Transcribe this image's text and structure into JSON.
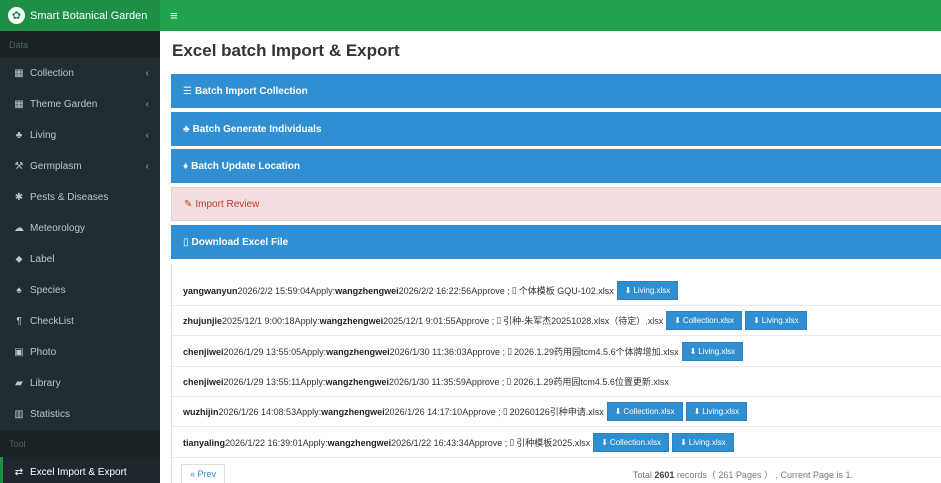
{
  "app": {
    "title": "Smart Botanical Garden",
    "menu_toggle": "≡",
    "accent_color": "#22a34e",
    "sidebar_bg": "#222d32"
  },
  "sidebar": {
    "section_data": "Data",
    "section_tool": "Tool",
    "items": [
      {
        "label": "Collection",
        "icon": "table-icon",
        "glyph": "▦",
        "has_children": true
      },
      {
        "label": "Theme Garden",
        "icon": "grid-icon",
        "glyph": "▦",
        "has_children": true
      },
      {
        "label": "Living",
        "icon": "tree-icon",
        "glyph": "♣",
        "has_children": true
      },
      {
        "label": "Germplasm",
        "icon": "magic-icon",
        "glyph": "⚒",
        "has_children": true
      },
      {
        "label": "Pests & Diseases",
        "icon": "bug-icon",
        "glyph": "✱",
        "has_children": false
      },
      {
        "label": "Meteorology",
        "icon": "cloud-icon",
        "glyph": "☁",
        "has_children": false
      },
      {
        "label": "Label",
        "icon": "tag-icon",
        "glyph": "⬥",
        "has_children": false
      },
      {
        "label": "Species",
        "icon": "leaf-icon",
        "glyph": "♠",
        "has_children": false
      },
      {
        "label": "CheckList",
        "icon": "paragraph-icon",
        "glyph": "¶",
        "has_children": false
      },
      {
        "label": "Photo",
        "icon": "image-icon",
        "glyph": "▣",
        "has_children": false
      },
      {
        "label": "Library",
        "icon": "book-icon",
        "glyph": "▰",
        "has_children": false
      },
      {
        "label": "Statistics",
        "icon": "bar-chart-icon",
        "glyph": "▥",
        "has_children": false
      }
    ],
    "tool_item": {
      "label": "Excel Import & Export",
      "icon": "exchange-icon",
      "glyph": "⇄"
    },
    "chevron": "‹"
  },
  "page": {
    "title": "Excel batch Import & Export"
  },
  "panels": [
    {
      "label": "Batch Import Collection",
      "icon": "list-icon",
      "glyph": "☰"
    },
    {
      "label": "Batch Generate Individuals",
      "icon": "tree-icon",
      "glyph": "♣"
    },
    {
      "label": "Batch Update Location",
      "icon": "map-marker-icon",
      "glyph": "♦"
    },
    {
      "label": "Import Review",
      "icon": "edit-icon",
      "glyph": "✎"
    },
    {
      "label": "Download Excel File",
      "icon": "file-icon",
      "glyph": "▯"
    }
  ],
  "records": [
    {
      "applicant": "yangwanyun",
      "apply_time": "2026/2/2 15:59:04",
      "apply_word": "Apply:",
      "approver": "wangzhengwei",
      "approve_time": "2026/2/2 16:22:56",
      "approve_word": "Approve ;",
      "file": "个体模板 GQU-102.xlsx",
      "buttons": [
        "Living.xlsx"
      ]
    },
    {
      "applicant": "zhujunjie",
      "apply_time": "2025/12/1 9:00:18",
      "apply_word": "Apply:",
      "approver": "wangzhengwei",
      "approve_time": "2025/12/1 9:01:55",
      "approve_word": "Approve ;",
      "file": "引种-朱军杰20251028.xlsx（待定）.xlsx",
      "buttons": [
        "Collection.xlsx",
        "Living.xlsx"
      ]
    },
    {
      "applicant": "chenjiwei",
      "apply_time": "2026/1/29 13:55:05",
      "apply_word": "Apply:",
      "approver": "wangzhengwei",
      "approve_time": "2026/1/30 11:36:03",
      "approve_word": "Approve ;",
      "file": "2026.1.29药用园tcm4.5.6个体牌增加.xlsx",
      "buttons": [
        "Living.xlsx"
      ]
    },
    {
      "applicant": "chenjiwei",
      "apply_time": "2026/1/29 13:55:11",
      "apply_word": "Apply:",
      "approver": "wangzhengwei",
      "approve_time": "2026/1/30 11:35:59",
      "approve_word": "Approve ;",
      "file": "2026.1.29药用园tcm4.5.6位置更新.xlsx",
      "buttons": []
    },
    {
      "applicant": "wuzhijin",
      "apply_time": "2026/1/26 14:08:53",
      "apply_word": "Apply:",
      "approver": "wangzhengwei",
      "approve_time": "2026/1/26 14:17:10",
      "approve_word": "Approve ;",
      "file": "20260126引种申请.xlsx",
      "buttons": [
        "Collection.xlsx",
        "Living.xlsx"
      ]
    },
    {
      "applicant": "tianyaling",
      "apply_time": "2026/1/22 16:39:01",
      "apply_word": "Apply:",
      "approver": "wangzhengwei",
      "approve_time": "2026/1/22 16:43:34",
      "approve_word": "Approve ;",
      "file": "引种模板2025.xlsx",
      "buttons": [
        "Collection.xlsx",
        "Living.xlsx"
      ]
    }
  ],
  "pagination": {
    "prev_label": "« Prev",
    "total_prefix": "Total",
    "total_records": "2601",
    "total_suffix": "records（ 261 Pages ） , Current Page is 1."
  }
}
